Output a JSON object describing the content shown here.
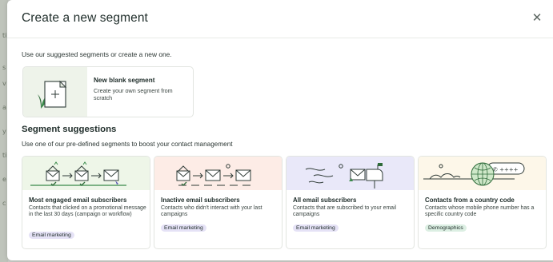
{
  "modal": {
    "title": "Create a new segment",
    "close_symbol": "✕",
    "intro": "Use our suggested segments or create a new one."
  },
  "blank_segment": {
    "title": "New blank segment",
    "description": "Create your own segment from scratch",
    "icon": "new-document-plus-icon"
  },
  "suggestions": {
    "title": "Segment suggestions",
    "subtitle": "Use one of our pre-defined segments to boost your contact management",
    "cards": [
      {
        "title": "Most engaged email subscribers",
        "description": "Contacts that clicked on a promotional message in the last 30 days (campaign or workflow)",
        "tag": "Email marketing",
        "art_bg": "#eef6e8",
        "icon": "engaged-emails-icon"
      },
      {
        "title": "Inactive email subscribers",
        "description": "Contacts who didn't interact with your last campaigns",
        "tag": "Email marketing",
        "art_bg": "#fdece6",
        "icon": "inactive-emails-icon"
      },
      {
        "title": "All email subscribers",
        "description": "Contacts that are subscribed to your email campaigns",
        "tag": "Email marketing",
        "art_bg": "#e9e8f9",
        "icon": "mailbox-icon"
      },
      {
        "title": "Contacts from a country code",
        "description": "Contacts whose mobile phone number has a specific country code",
        "tag": "Demographics",
        "art_bg": "#fdf7e9",
        "icon": "globe-phone-icon"
      }
    ]
  },
  "colors": {
    "text": "#1f2d2a",
    "email_tag": "#e5e2f6",
    "demographics_tag": "#dcefe3",
    "accent_green": "#2f6b3a"
  }
}
